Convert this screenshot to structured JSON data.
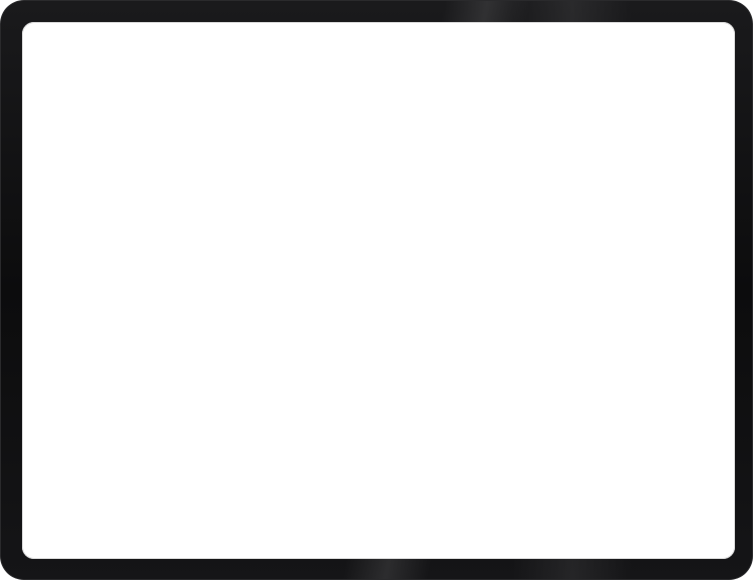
{
  "device": {
    "frame_color": "#111113",
    "screen_color": "#ffffff"
  },
  "screen": {
    "state": "blank"
  }
}
